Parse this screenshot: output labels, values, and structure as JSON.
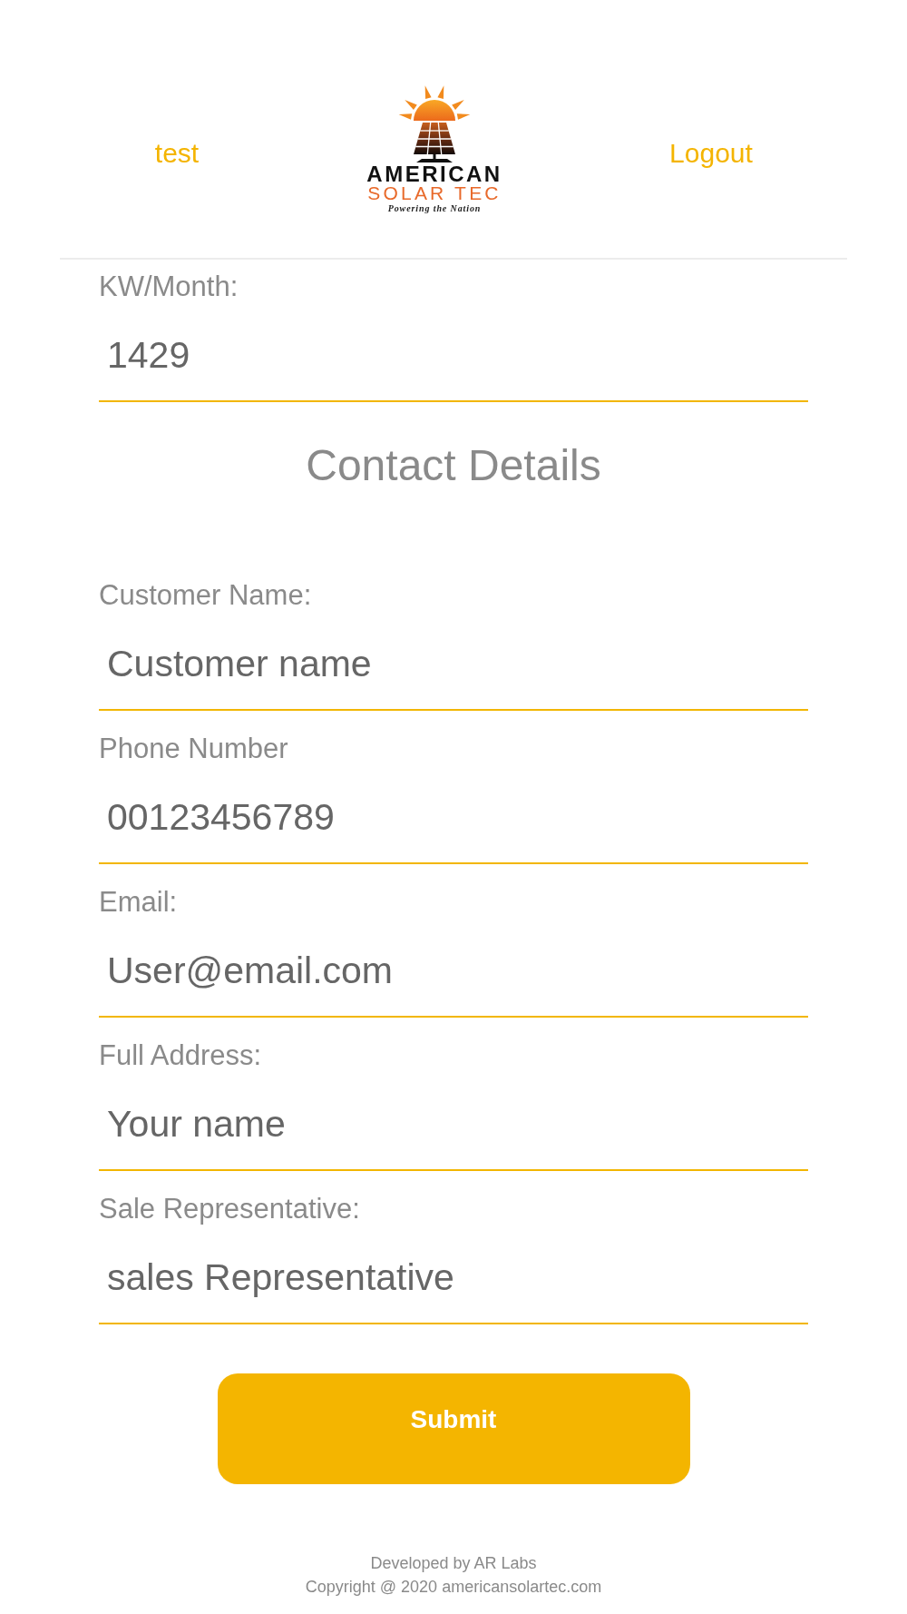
{
  "header": {
    "user_link": "test",
    "logo": {
      "title": "AMERICAN",
      "subtitle": "SOLAR TEC",
      "tagline": "Powering the Nation"
    },
    "logout_link": "Logout"
  },
  "usage_field": {
    "label": "KW/Month:",
    "value": "1429"
  },
  "section_title": "Contact Details",
  "fields": [
    {
      "label": "Customer Name:",
      "placeholder": "Customer name"
    },
    {
      "label": "Phone Number",
      "placeholder": "00123456789"
    },
    {
      "label": "Email:",
      "placeholder": "User@email.com"
    },
    {
      "label": "Full Address:",
      "placeholder": "Your name"
    },
    {
      "label": "Sale Representative:",
      "placeholder": "sales Representative"
    }
  ],
  "submit_button": "Submit",
  "footer": {
    "credit": "Developed by AR Labs",
    "copyright": "Copyright @ 2020 americansolartec.com"
  }
}
